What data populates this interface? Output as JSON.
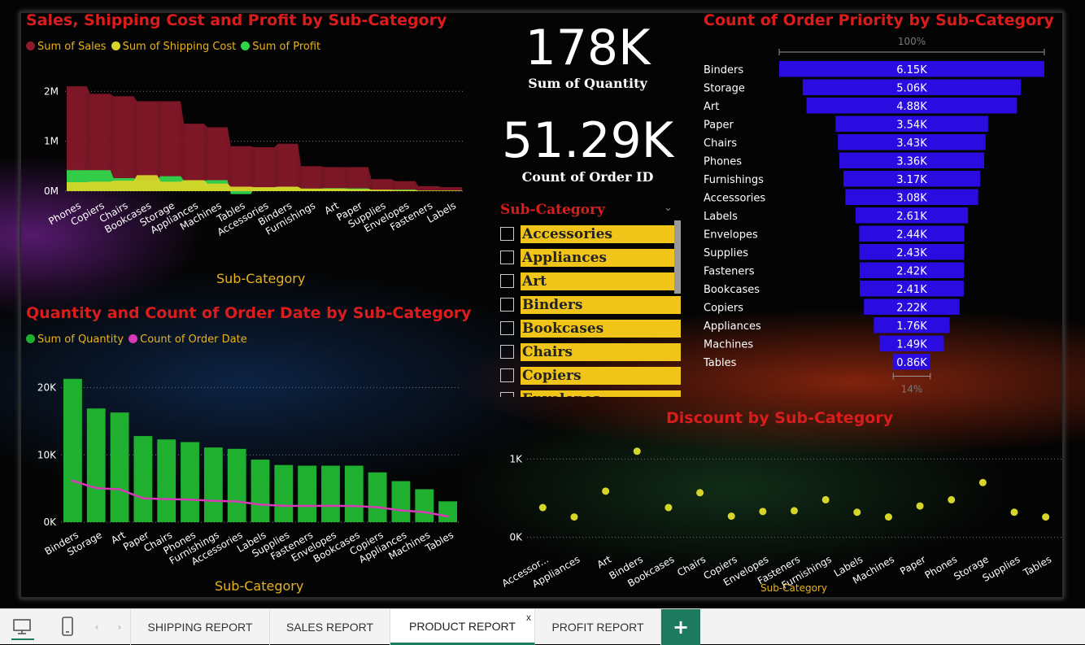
{
  "kpis": [
    {
      "value": "178K",
      "label": "Sum of Quantity"
    },
    {
      "value": "51.29K",
      "label": "Count of Order ID"
    }
  ],
  "slicer": {
    "title": "Sub-Category",
    "items": [
      "Accessories",
      "Appliances",
      "Art",
      "Binders",
      "Bookcases",
      "Chairs",
      "Copiers",
      "Envelopes"
    ]
  },
  "colors": {
    "sales": "#8b1a2b",
    "shipping": "#d6d62a",
    "profit": "#2fd64a",
    "quantity": "#1fb02f",
    "orderdate": "#d63ab6",
    "funnel": "#2a0be0",
    "discount": "#d6d62a",
    "title": "#d91c1c",
    "axis": "#e8b31b"
  },
  "tabs": {
    "items": [
      "SHIPPING REPORT",
      "SALES REPORT",
      "PRODUCT REPORT",
      "PROFIT REPORT"
    ],
    "active": "PRODUCT REPORT",
    "close_glyph": "x",
    "add_glyph": "+"
  },
  "icons": [
    "desktop-icon",
    "phone-icon",
    "prev-arrow-icon",
    "next-arrow-icon"
  ],
  "chart_data": [
    {
      "type": "area",
      "title": "Sales, Shipping Cost and Profit by Sub-Category",
      "xlabel": "Sub-Category",
      "ylabel": "",
      "ylim": [
        0,
        2200000
      ],
      "yticks": [
        "2M",
        "1M",
        "0M"
      ],
      "ytick_values": [
        2000000,
        1000000,
        0
      ],
      "categories": [
        "Phones",
        "Copiers",
        "Chairs",
        "Bookcases",
        "Storage",
        "Appliances",
        "Machines",
        "Tables",
        "Accessories",
        "Binders",
        "Furnishings",
        "Art",
        "Paper",
        "Supplies",
        "Envelopes",
        "Fasteners",
        "Labels"
      ],
      "series": [
        {
          "name": "Sum of Sales",
          "values": [
            2100000,
            1950000,
            1900000,
            1800000,
            1800000,
            1350000,
            1280000,
            900000,
            880000,
            950000,
            500000,
            480000,
            480000,
            240000,
            200000,
            100000,
            80000
          ]
        },
        {
          "name": "Sum of Shipping Cost",
          "values": [
            180000,
            190000,
            210000,
            320000,
            190000,
            220000,
            150000,
            90000,
            80000,
            90000,
            50000,
            50000,
            40000,
            30000,
            20000,
            10000,
            10000
          ]
        },
        {
          "name": "Sum of Profit",
          "values": [
            420000,
            420000,
            260000,
            220000,
            300000,
            210000,
            220000,
            -60000,
            70000,
            80000,
            50000,
            60000,
            55000,
            20000,
            30000,
            10000,
            10000
          ]
        }
      ],
      "grid": true,
      "legend": "top-left"
    },
    {
      "type": "bar",
      "title": "Quantity and Count of Order Date by Sub-Category",
      "xlabel": "Sub-Category",
      "ylabel": "",
      "ylim": [
        0,
        22000
      ],
      "yticks": [
        "20K",
        "10K",
        "0K"
      ],
      "ytick_values": [
        20000,
        10000,
        0
      ],
      "categories": [
        "Binders",
        "Storage",
        "Art",
        "Paper",
        "Chairs",
        "Phones",
        "Furnishings",
        "Accessories",
        "Labels",
        "Supplies",
        "Fasteners",
        "Envelopes",
        "Bookcases",
        "Copiers",
        "Appliances",
        "Machines",
        "Tables"
      ],
      "series": [
        {
          "name": "Sum of Quantity",
          "type": "bar",
          "values": [
            21300,
            16900,
            16300,
            12800,
            12300,
            11900,
            11100,
            10900,
            9300,
            8500,
            8400,
            8400,
            8400,
            7400,
            6100,
            4900,
            3100
          ]
        },
        {
          "name": "Count of Order Date",
          "type": "line",
          "values": [
            6150,
            5060,
            4880,
            3540,
            3430,
            3360,
            3170,
            3080,
            2610,
            2430,
            2420,
            2440,
            2410,
            2220,
            1760,
            1490,
            860
          ]
        }
      ],
      "grid": true,
      "legend": "top-left"
    },
    {
      "type": "bar",
      "orientation": "funnel",
      "title": "Count of Order Priority by Sub-Category",
      "top_label": "100%",
      "bottom_label": "14%",
      "categories": [
        "Binders",
        "Storage",
        "Art",
        "Paper",
        "Chairs",
        "Phones",
        "Furnishings",
        "Accessories",
        "Labels",
        "Envelopes",
        "Supplies",
        "Fasteners",
        "Bookcases",
        "Copiers",
        "Appliances",
        "Machines",
        "Tables"
      ],
      "values": [
        6150,
        5060,
        4880,
        3540,
        3430,
        3360,
        3170,
        3080,
        2610,
        2440,
        2430,
        2420,
        2410,
        2220,
        1760,
        1490,
        860
      ],
      "labels": [
        "6.15K",
        "5.06K",
        "4.88K",
        "3.54K",
        "3.43K",
        "3.36K",
        "3.17K",
        "3.08K",
        "2.61K",
        "2.44K",
        "2.43K",
        "2.42K",
        "2.41K",
        "2.22K",
        "1.76K",
        "1.49K",
        "0.86K"
      ]
    },
    {
      "type": "scatter",
      "title": "Discount by Sub-Category",
      "xlabel": "Sub-Category",
      "ylabel": "",
      "ylim": [
        -150,
        1150
      ],
      "yticks": [
        "1K",
        "0K"
      ],
      "ytick_values": [
        1000,
        0
      ],
      "categories": [
        "Accessor...",
        "Appliances",
        "Art",
        "Binders",
        "Bookcases",
        "Chairs",
        "Copiers",
        "Envelopes",
        "Fasteners",
        "Furnishings",
        "Labels",
        "Machines",
        "Paper",
        "Phones",
        "Storage",
        "Supplies",
        "Tables"
      ],
      "values": [
        380,
        260,
        590,
        1100,
        380,
        570,
        270,
        330,
        340,
        480,
        320,
        260,
        400,
        480,
        700,
        320,
        260
      ],
      "grid": true
    }
  ]
}
